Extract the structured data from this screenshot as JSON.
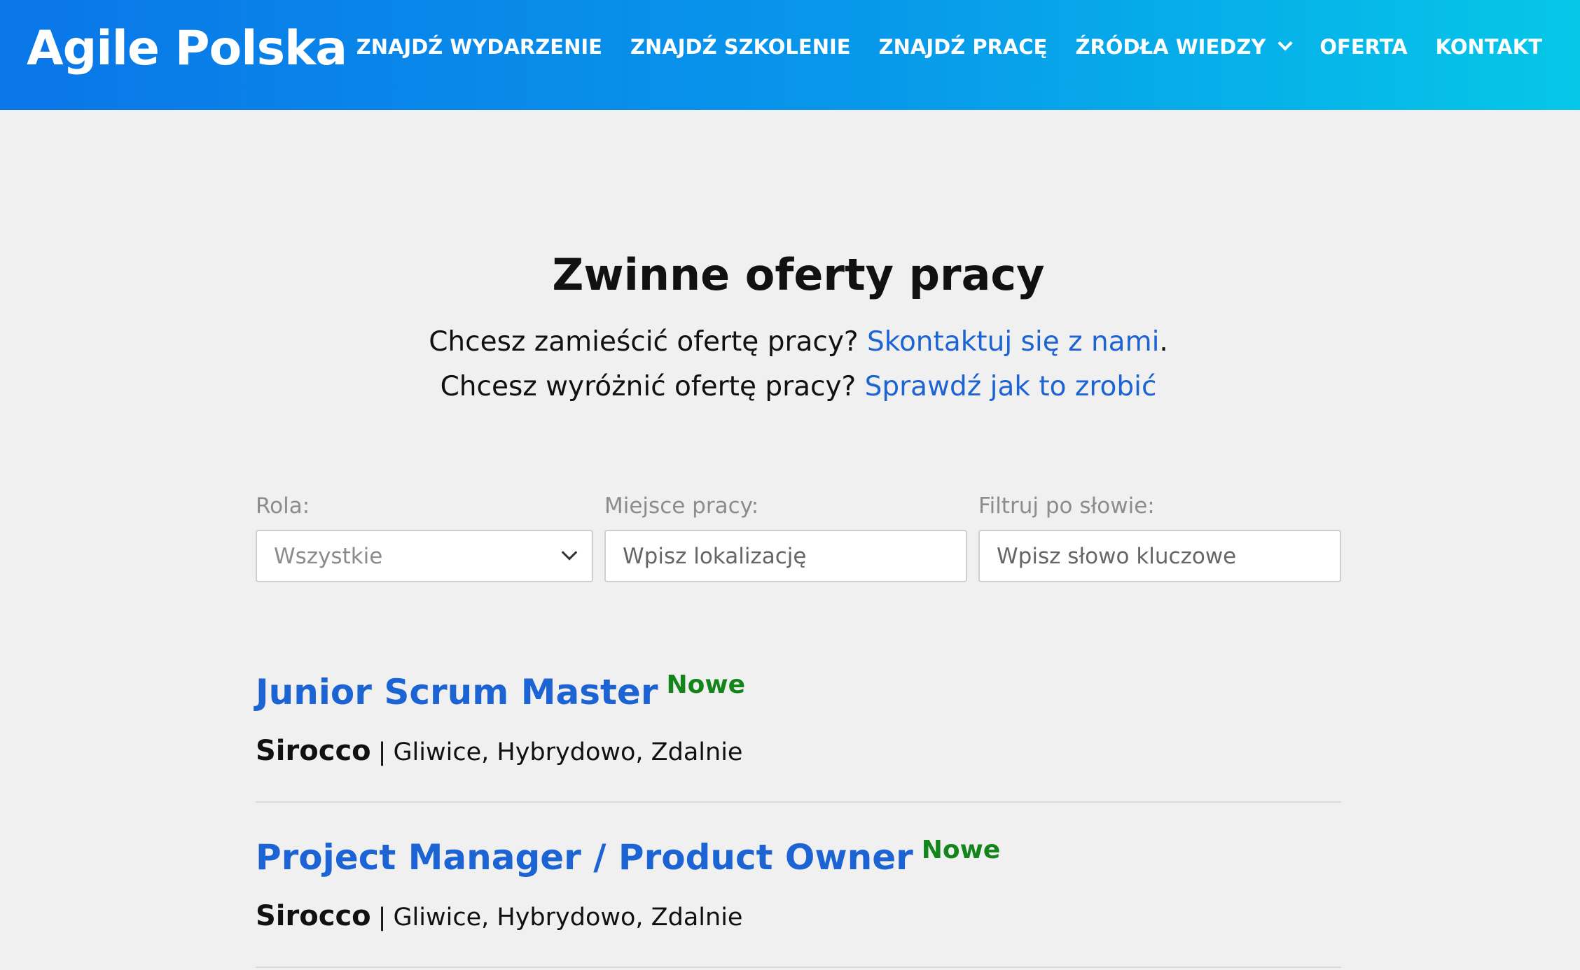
{
  "header": {
    "logo": "Agile Polska",
    "nav": [
      {
        "label": "ZNAJDŹ WYDARZENIE"
      },
      {
        "label": "ZNAJDŹ SZKOLENIE"
      },
      {
        "label": "ZNAJDŹ PRACĘ"
      },
      {
        "label": "ŹRÓDŁA WIEDZY",
        "icon": "chevron-down-icon"
      },
      {
        "label": "OFERTA"
      },
      {
        "label": "KONTAKT"
      }
    ]
  },
  "intro": {
    "title": "Zwinne oferty pracy",
    "line1_text": "Chcesz zamieścić ofertę pracy? ",
    "line1_link": "Skontaktuj się z nami",
    "line1_end": ".",
    "line2_text": "Chcesz wyróżnić ofertę pracy? ",
    "line2_link": "Sprawdź jak to zrobić"
  },
  "filters": {
    "role": {
      "label": "Rola:",
      "value": "Wszystkie"
    },
    "location": {
      "label": "Miejsce pracy:",
      "placeholder": "Wpisz lokalizację"
    },
    "keyword": {
      "label": "Filtruj po słowie:",
      "placeholder": "Wpisz słowo kluczowe"
    }
  },
  "jobs": [
    {
      "title": "Junior Scrum Master",
      "badge": "Nowe",
      "company": "Sirocco",
      "separator": "|",
      "locations": "Gliwice, Hybrydowo, Zdalnie"
    },
    {
      "title": "Project Manager / Product Owner",
      "badge": "Nowe",
      "company": "Sirocco",
      "separator": "|",
      "locations": "Gliwice, Hybrydowo, Zdalnie"
    }
  ],
  "colors": {
    "header_gradient_start": "#0a76e8",
    "header_gradient_end": "#05c7e8",
    "link": "#1c63d4",
    "badge_new": "#14851b",
    "background": "#f0f0f0"
  }
}
